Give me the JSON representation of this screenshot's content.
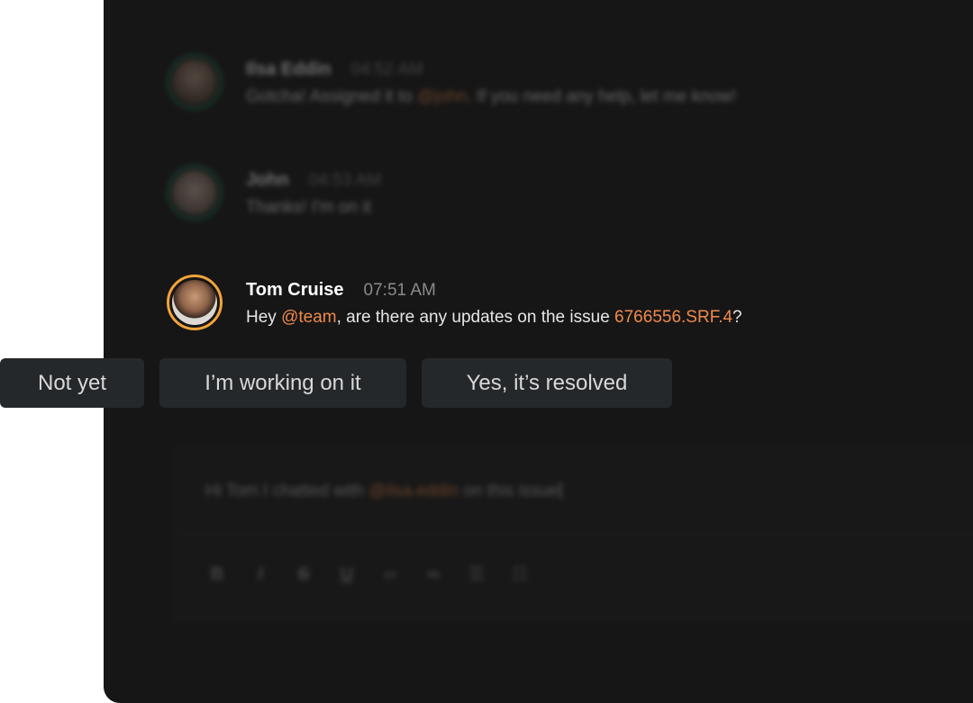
{
  "messages": [
    {
      "author": "Ilsa Eddin",
      "time": "04:52 AM",
      "text_before": "Gotcha! Assigned it to ",
      "mention": "@john",
      "text_after": ". If you need any help, let me know!"
    },
    {
      "author": "John",
      "time": "04:53 AM",
      "text": "Thanks! I'm on it"
    },
    {
      "author": "Tom Cruise",
      "time": "07:51 AM",
      "text_before": "Hey ",
      "mention": "@team",
      "text_middle": ", are there any updates on the issue ",
      "issue_ref": "6766556.SRF.4",
      "text_after": "?"
    }
  ],
  "quick_replies": [
    "Not yet",
    "I’m working on it",
    "Yes, it’s resolved"
  ],
  "composer": {
    "text_before": "Hi Tom I chatted with ",
    "mention": "@ilsa.eddin",
    "text_after": " on this issue"
  },
  "toolbar": [
    "bold-icon",
    "italic-icon",
    "strikethrough-icon",
    "underline-icon",
    "code-icon",
    "link-icon",
    "bullet-list-icon",
    "numbered-list-icon"
  ],
  "colors": {
    "background": "#161616",
    "mention": "#f08a4b",
    "reply_button": "#25282b",
    "avatar_ring_online": "#1e7a52",
    "avatar_ring_active": "#f2a33a"
  }
}
